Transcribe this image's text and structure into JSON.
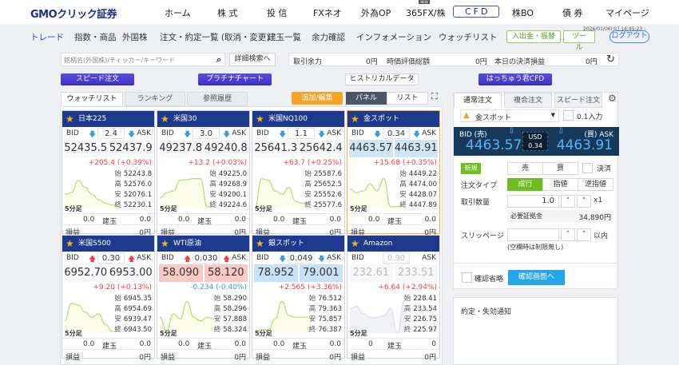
{
  "header": {
    "logo": "GMOクリック証券",
    "new_badge": "NEW",
    "nav": [
      "ホーム",
      "株 式",
      "投 信",
      "FXネオ",
      "外為OP",
      "365FX/株",
      "CFD",
      "株BO",
      "債 券",
      "マイページ"
    ],
    "active": "CFD"
  },
  "subnav": {
    "items": [
      "トレード",
      "指数・商品",
      "外国株",
      "注文・約定一覧 (取消・変更)",
      "建玉一覧",
      "余力確認",
      "インフォメーション",
      "ウォッチリスト"
    ],
    "deposit": "入出金・振替",
    "tools": "ツール",
    "logout": "ログアウト",
    "timestamp": "2026/01/06(火) 14:45:23"
  },
  "search": {
    "placeholder": "銘柄名(外国株)/ティッカー/キーワード",
    "detail": "詳細検索へ"
  },
  "account": {
    "margin_label": "取引余力",
    "margin": "0円",
    "valuation_label": "時価評価総額",
    "valuation": "0円",
    "pl_label": "本日の決済損益",
    "pl": "0円"
  },
  "actions": {
    "speed": "スピード注文",
    "platinum": "プラチナチャート",
    "historical": "ヒストリカルデータ",
    "hacchu": "はっちゅう君CFD"
  },
  "tabs": {
    "watchlist": "ウォッチリスト",
    "ranking": "ランキング",
    "history": "参照履歴",
    "add_edit": "追加/編集",
    "panel": "パネル",
    "list": "リスト"
  },
  "labels": {
    "bid": "BID",
    "ask": "ASK",
    "open": "始",
    "high": "高",
    "low": "安",
    "close": "終",
    "tf": "5分足",
    "pos": "建玉",
    "pl": "損益"
  },
  "colors": {
    "up": "#f04040",
    "down": "#3a9ae0",
    "header": "#1e3a8e"
  },
  "cards": [
    {
      "name": "日本225",
      "spread": "2.4",
      "dir": "down",
      "bid": "52435.5",
      "ask": "52437.9",
      "change": "+205.4 (+0.39%)",
      "open": "52243.8",
      "high": "52576.0",
      "low": "52076.1",
      "close": "52230.1",
      "buy_qty": "0.0",
      "sell_qty": "0.0",
      "pl": "0円",
      "spark": [
        40,
        45,
        80,
        60,
        40,
        25,
        15,
        10,
        5
      ]
    },
    {
      "name": "米国30",
      "spread": "3.0",
      "dir": "down",
      "bid": "49237.8",
      "ask": "49240.8",
      "change": "+13.2 (+0.03%)",
      "open": "49225.0",
      "high": "49268.9",
      "low": "49200.1",
      "close": "49224.6",
      "buy_qty": "0.0",
      "sell_qty": "0.0",
      "pl": "0円",
      "spark": [
        30,
        45,
        50,
        80,
        82,
        85,
        85,
        5,
        5
      ]
    },
    {
      "name": "米国NQ100",
      "spread": "1.1",
      "dir": "down",
      "bid": "25641.3",
      "ask": "25642.4",
      "change": "+63.7 (+0.25%)",
      "open": "25587.6",
      "high": "25652.5",
      "low": "25552.6",
      "close": "25577.6",
      "buy_qty": "0.0",
      "sell_qty": "0.0",
      "pl": "0円",
      "spark": [
        0,
        85,
        80,
        50,
        40,
        60,
        20,
        15,
        15
      ]
    },
    {
      "name": "金スポット",
      "spread": "0.34",
      "dir": "down",
      "bid": "4463.57",
      "ask": "4463.91",
      "change": "+15.68 (+0.35%)",
      "open": "4449.22",
      "high": "4474.00",
      "low": "4428.07",
      "close": "4447.89",
      "buy_qty": "0.0",
      "sell_qty": "0.0",
      "pl": "0円",
      "spark": [
        55,
        45,
        50,
        70,
        50,
        85,
        5,
        5,
        10
      ],
      "selected": true
    },
    {
      "name": "米国S500",
      "spread": "0.30",
      "dir": "up",
      "bid": "6952.70",
      "ask": "6953.00",
      "change": "+9.20 (+0.13%)",
      "open": "6945.35",
      "high": "6954.69",
      "low": "6939.47",
      "close": "6943.50",
      "buy_qty": "0.0",
      "sell_qty": "0.0",
      "pl": "0円",
      "spark": [
        35,
        85,
        80,
        60,
        45,
        55,
        25,
        5,
        5
      ]
    },
    {
      "name": "WTI原油",
      "spread": "0.030",
      "dir": "up",
      "bid": "58.090",
      "ask": "58.120",
      "change": "-0.234 (-0.40%)",
      "open": "58.290",
      "high": "58.296",
      "low": "57.888",
      "close": "58.324",
      "buy_qty": "0.0",
      "sell_qty": "0.0",
      "pl": "0円",
      "spark": [
        45,
        5,
        55,
        40,
        90,
        45,
        35,
        45,
        40
      ],
      "flash": "up"
    },
    {
      "name": "銀スポット",
      "spread": "0.049",
      "dir": "down",
      "bid": "78.952",
      "ask": "79.001",
      "change": "+2.565 (+3.36%)",
      "open": "76.512",
      "high": "79.363",
      "low": "75.857",
      "close": "76.387",
      "buy_qty": "0.0",
      "sell_qty": "0.0",
      "pl": "0円",
      "spark": [
        5,
        10,
        10,
        40,
        90,
        50,
        45,
        45,
        45
      ],
      "flash": "down"
    },
    {
      "name": "Amazon",
      "spread": "0.90",
      "dir": "none",
      "bid": "232.61",
      "ask": "233.51",
      "change": "+6.64 (+2.94%)",
      "open": "228.41",
      "high": "233.54",
      "low": "226.75",
      "close": "225.97",
      "buy_qty": "0",
      "sell_qty": "0",
      "pl": "0円",
      "spark": [
        70,
        75,
        55,
        45,
        45,
        50,
        70,
        0,
        90
      ],
      "disabled": true
    }
  ],
  "order": {
    "tabs": [
      "通常注文",
      "複合注文",
      "スピード注文"
    ],
    "symbol": "金スポット",
    "decimal_input": "0.1入力",
    "bid_label": "BID (売)",
    "ask_label": "(買) ASK",
    "bid": "4463.57",
    "ask": "4463.91",
    "currency": "USD",
    "spread": "0.34",
    "new": "新規",
    "sell": "売",
    "buy": "買",
    "settle": "決済",
    "type_label": "注文タイプ",
    "types": [
      "成行",
      "指値",
      "逆指値"
    ],
    "qty_label": "取引数量",
    "qty": "1.0",
    "multiplier": "x1",
    "margin_label": "必要証拠金",
    "margin": "34,890円",
    "slippage_label": "スリッページ",
    "slippage_unit": "以内",
    "slippage_note": "(空欄時は制限無し)",
    "skip_confirm": "確認省略",
    "confirm": "確認画面へ"
  },
  "notice": {
    "title": "約定・失効通知"
  }
}
